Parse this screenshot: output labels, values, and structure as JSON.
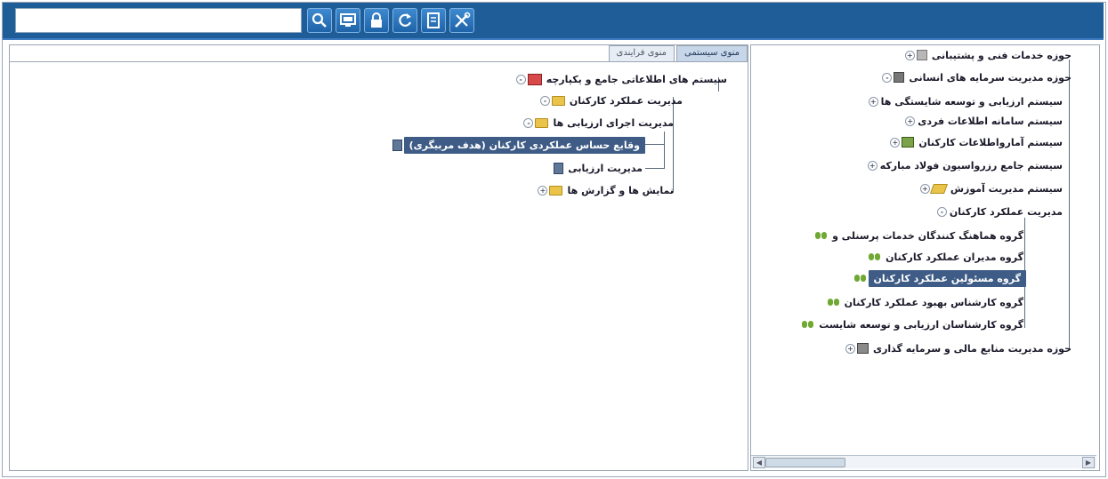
{
  "toolbar": {
    "search_value": "",
    "buttons": [
      {
        "name": "search-icon"
      },
      {
        "name": "monitor-icon"
      },
      {
        "name": "lock-icon"
      },
      {
        "name": "refresh-icon"
      },
      {
        "name": "document-icon"
      },
      {
        "name": "tools-icon"
      }
    ]
  },
  "left_pane": {
    "tabs": [
      "منوی سیستمی",
      "منوی فرایندی"
    ],
    "tree": [
      {
        "label": "سیستم های اطلاعاتی جامع و یکپارچه"
      },
      {
        "label": "مدیریت عملکرد کارکنان"
      },
      {
        "label": "مدیریت اجرای ارزیابی ها"
      },
      {
        "label": "وقایع حساس عملکردی کارکنان (هدف مربیگری)"
      },
      {
        "label": "مدیریت ارزیابی"
      },
      {
        "label": "نمایش ها و گزارش ها"
      }
    ]
  },
  "right_pane": {
    "tree": [
      {
        "label": "حوزه خدمات فنی و پشتیبانی"
      },
      {
        "label": "حوزه مدیریت سرمایه های انسانی"
      },
      {
        "label": "سیستم ارزیابی و توسعه شایستگی ها"
      },
      {
        "label": "سیستم سامانه اطلاعات فردی"
      },
      {
        "label": "سیستم آمارواطلاعات کارکنان"
      },
      {
        "label": "سیستم جامع رزرواسیون فولاد مبارکه"
      },
      {
        "label": "سیستم مدیریت آموزش"
      },
      {
        "label": "مدیریت عملکرد کارکنان"
      },
      {
        "label": "گروه هماهنگ کنندگان خدمات پرسنلی و"
      },
      {
        "label": "گروه  مدیران عملکرد کارکنان"
      },
      {
        "label": "گروه  مسئولین عملکرد کارکنان"
      },
      {
        "label": "گروه کارشناس بهبود عملکرد کارکنان"
      },
      {
        "label": "گروه کارشناسان ارزیابی و توسعه شایست"
      },
      {
        "label": "حوزه مدیریت منابع مالی و سرمایه گذاری"
      }
    ]
  }
}
